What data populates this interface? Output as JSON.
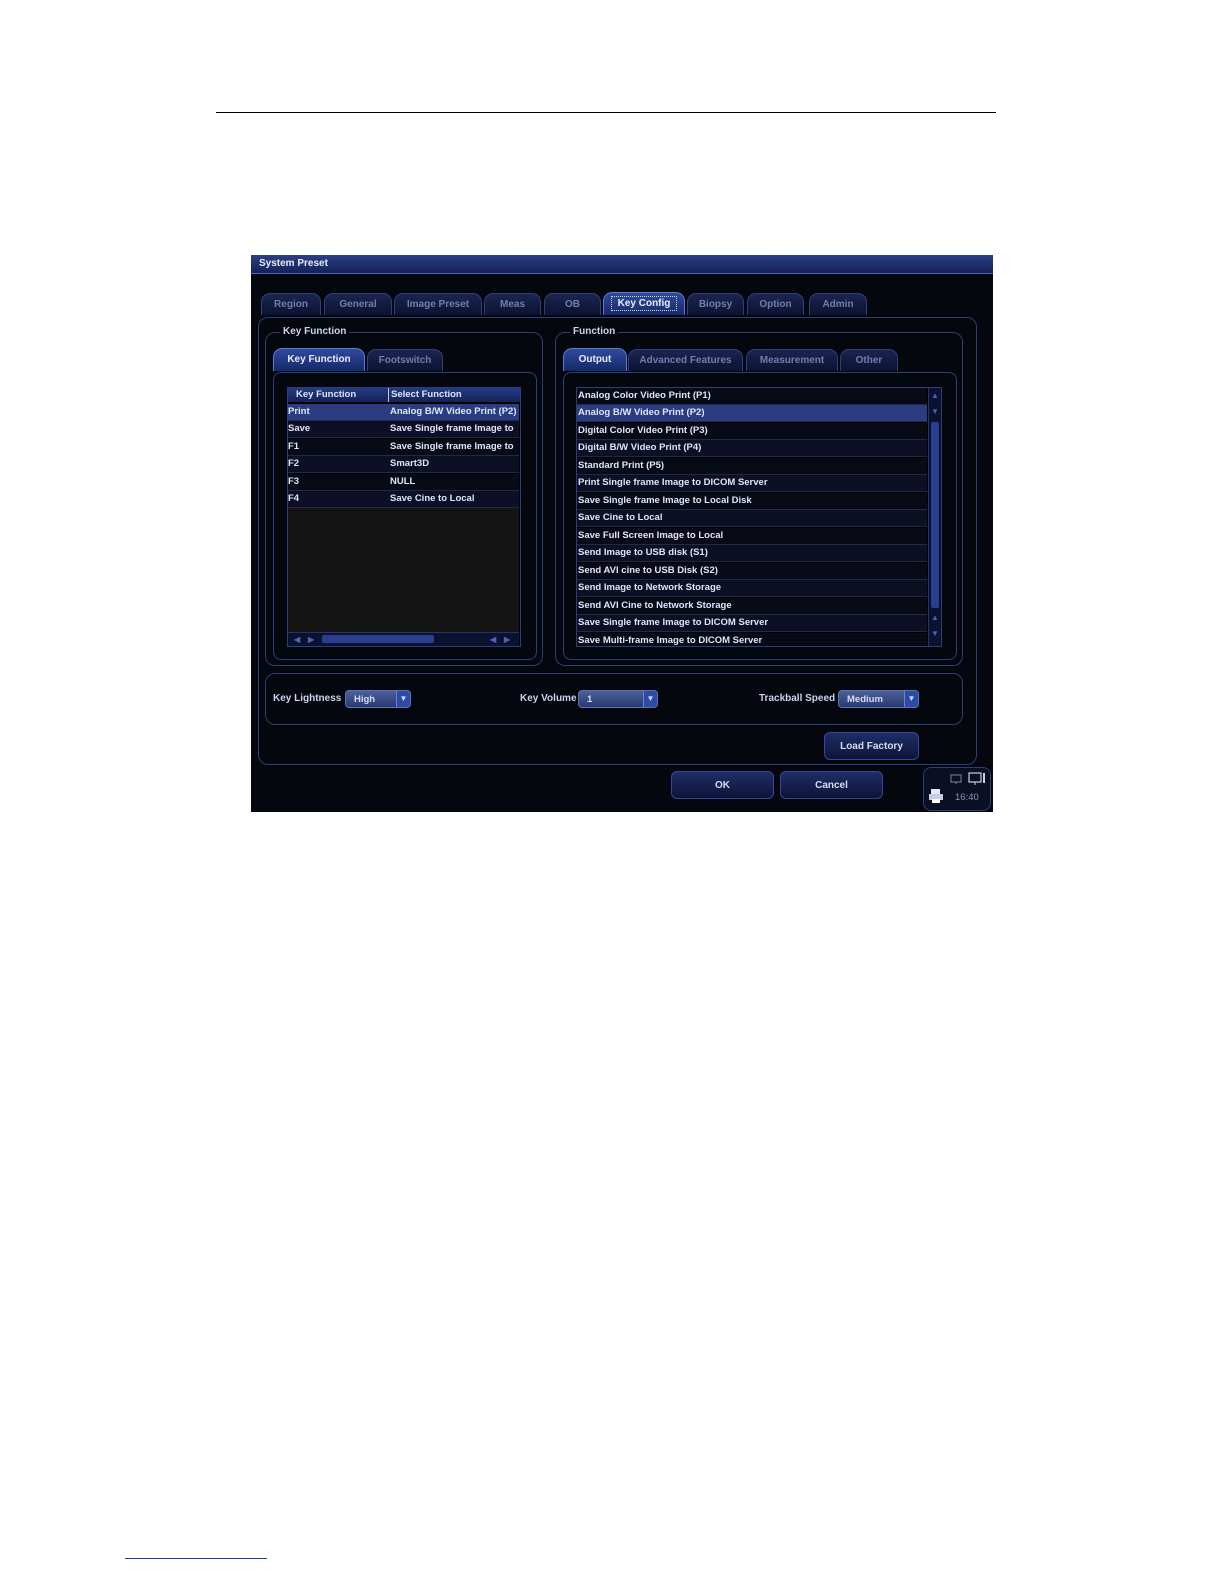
{
  "window": {
    "title": "System Preset"
  },
  "main_tabs": [
    "Region",
    "General",
    "Image Preset",
    "Meas",
    "OB",
    "Key Config",
    "Biopsy",
    "Option",
    "Admin"
  ],
  "active_main_tab": "Key Config",
  "left_group": {
    "title": "Key Function",
    "tabs": [
      "Key Function",
      "Footswitch"
    ],
    "active_tab": "Key Function",
    "columns": [
      "Key Function",
      "Select Function"
    ],
    "rows": [
      {
        "key": "Print",
        "func": "Analog B/W Video Print (P2)"
      },
      {
        "key": "Save",
        "func": "Save Single frame Image to"
      },
      {
        "key": "F1",
        "func": "Save Single frame Image to"
      },
      {
        "key": "F2",
        "func": "Smart3D"
      },
      {
        "key": "F3",
        "func": "NULL"
      },
      {
        "key": "F4",
        "func": "Save Cine to Local"
      }
    ],
    "selected_row": "Print"
  },
  "right_group": {
    "title": "Function",
    "tabs": [
      "Output",
      "Advanced Features",
      "Measurement",
      "Other"
    ],
    "active_tab": "Output",
    "items": [
      "Analog Color Video Print (P1)",
      "Analog B/W Video Print (P2)",
      "Digital Color Video Print (P3)",
      "Digital B/W Video Print (P4)",
      "Standard Print (P5)",
      "Print Single frame Image to DICOM Server",
      "Save Single frame Image to Local Disk",
      "Save Cine to Local",
      "Save Full Screen Image to Local",
      "Send Image to USB disk (S1)",
      "Send AVI cine to USB Disk (S2)",
      "Send Image to Network Storage",
      "Send AVI Cine to Network Storage",
      "Save Single frame Image to DICOM Server",
      "Save Multi-frame Image to DICOM Server"
    ],
    "selected_item": "Analog B/W Video Print (P2)"
  },
  "settings": {
    "key_lightness": {
      "label": "Key Lightness",
      "value": "High"
    },
    "key_volume": {
      "label": "Key Volume",
      "value": "1"
    },
    "trackball_speed": {
      "label": "Trackball Speed",
      "value": "Medium"
    }
  },
  "buttons": {
    "load_factory": "Load Factory",
    "ok": "OK",
    "cancel": "Cancel"
  },
  "tray": {
    "time": "16:40"
  },
  "colors": {
    "window_bg": "#05070e",
    "titlebar": "#1c2c6a",
    "selection": "#2c3c80",
    "border": "#2c3d78"
  }
}
